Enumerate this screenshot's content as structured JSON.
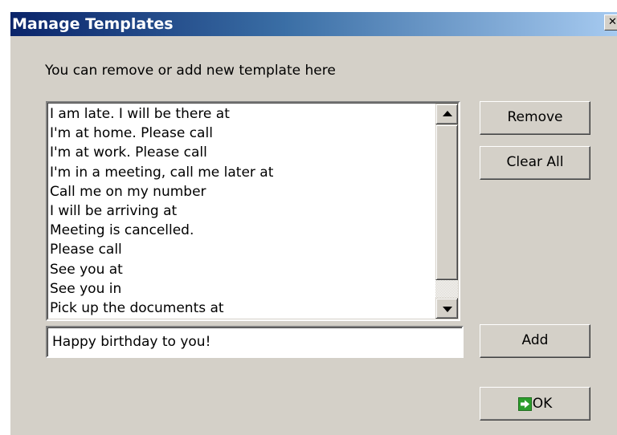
{
  "dialog": {
    "title": "Manage Templates",
    "close_icon": "close-icon",
    "instruction": "You can remove or add new template here"
  },
  "templates": {
    "items": [
      "I am late. I will be there at",
      "I'm at home. Please call",
      "I'm at work. Please call",
      "I'm in a meeting, call me later at",
      "Call me on my number",
      "I will be arriving at",
      "Meeting is cancelled.",
      "Please call",
      "See you at",
      "See you in",
      "Pick up the documents at"
    ]
  },
  "input": {
    "value": "Happy birthday to you!"
  },
  "buttons": {
    "remove": "Remove",
    "clear_all": "Clear All",
    "add": "Add",
    "ok": "OK",
    "ok_icon": "green-arrow-icon"
  },
  "colors": {
    "title_bar_start": "#0a246a",
    "title_bar_end": "#a6caf0",
    "dialog_bg": "#d4d0c8",
    "ok_icon": "#2c9d2c"
  }
}
